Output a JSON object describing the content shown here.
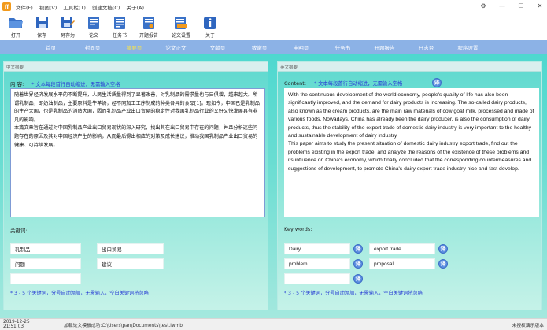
{
  "menubar": {
    "items": [
      "文件(F)",
      "视图(V)",
      "工具栏(T)",
      "创建文档(C)",
      "关于(A)"
    ]
  },
  "toolbar": {
    "items": [
      {
        "label": "打开",
        "icon": "folder-open-icon"
      },
      {
        "label": "保存",
        "icon": "save-icon"
      },
      {
        "label": "另存为",
        "icon": "save-as-icon"
      },
      {
        "label": "论文",
        "icon": "document-icon"
      },
      {
        "label": "任务书",
        "icon": "task-document-icon"
      },
      {
        "label": "开题报告",
        "icon": "proposal-document-icon"
      },
      {
        "label": "论文设置",
        "icon": "settings-document-icon"
      },
      {
        "label": "关于",
        "icon": "info-icon"
      }
    ]
  },
  "nav": {
    "items": [
      "首页",
      "封面页",
      "摘要页",
      "论文正文",
      "文献页",
      "致谢页",
      "申明页",
      "任务书",
      "开题报告",
      "日志台",
      "程序设置"
    ],
    "active_index": 2
  },
  "left_panel": {
    "header": "中文摘要",
    "content_label": "内  容:",
    "hint": "* 文本每段首行自动缩进，无需输入空格",
    "text": "随着世界经济发展水平的不断提升，人民生活质量得到了显著改善，对乳制品的需求量也与日俱增，越来越大。所谓乳制品，即奶油制品，主要原料是牛羊奶，经不同加工工序制成的种类各异的食品[1]。现如今，中国已是乳制品的生产大国，也是乳制品的消费大国，因而乳制品产业出口贸易的稳定性对我国乳制品行业的又好又快发展具有非凡的影响。\n本篇文章旨在通过对中国乳制品产业出口贸易现状的深入研究，找出其在出口贸易中存在的问题，并且分析这些问题存在的原因及其对中国经济产生的影响，从而最后得出相应的对策及成长建议，推动我国乳制品产业出口贸易的健康、可持续发展。",
    "keywords_title": "关键词:",
    "keywords": [
      "乳制品",
      "出口贸易",
      "问题",
      "建议"
    ],
    "keywords_tip": "* 3 - 5 个关键词，分号自动添加，无需输入，空白关键词将忽略"
  },
  "right_panel": {
    "header": "英文摘要",
    "content_label": "Content:",
    "hint": "* 文本每段首行自动缩进，无需输入空格",
    "text": "With the continuous development of the world economy, people's quality of life has also been significantly improved, and the demand for dairy products is increasing. The so-called dairy products, also known as the cream products, are the main raw materials of cow goat milk, processed and made of various foods. Nowadays, China has already been the dairy producer, is also the consumption of dairy products, thus the stability of the export trade of domestic dairy industry is very important to the healthy and sustainable development of dairy industry.\nThis paper aims to study the present situation of domestic dairy industry export trade, find out the problems existing in the export trade, and analyze the reasons of the existence of these problems and its influence on China's economy, which finally concluded that the corresponding countermeasures and suggestions of development, to promote China's dairy export trade industry nice and fast develop.",
    "keywords_title": "Key words:",
    "keywords": [
      "Dairy",
      "export trade",
      "problem",
      "proposal",
      ""
    ],
    "keywords_tip": "* 3 - 5 个关键词，分号自动添加，无需输入，空白关键词将忽略"
  },
  "statusbar": {
    "time": "2019-12-25 21:51:03",
    "message": "加载论文模板成功:C:\\Users\\pan\\Documents\\test.lwmb",
    "right": "未授权演示版本"
  },
  "colors": {
    "nav_bg": "#8cb2e6",
    "nav_active": "#f7e34b",
    "hint_blue": "#2a3fd4",
    "panel_teal": "#5ed9cf"
  }
}
